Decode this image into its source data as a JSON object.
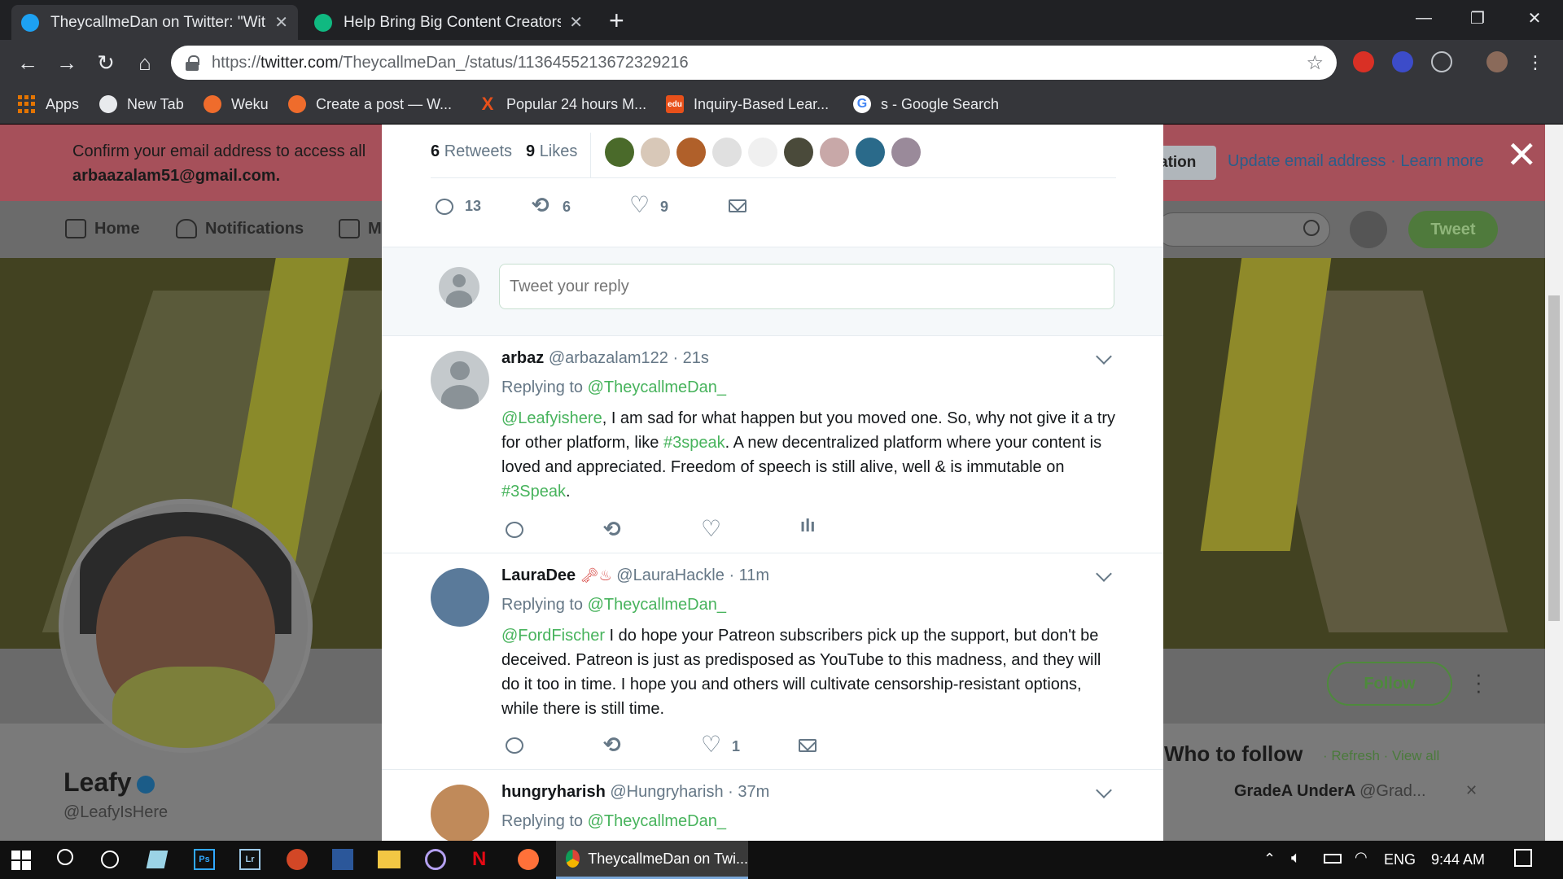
{
  "browser": {
    "tabs": [
      {
        "title": "TheycallmeDan on Twitter: \"With",
        "favicon": "twitter-bird-icon",
        "active": true
      },
      {
        "title": "Help Bring Big Content Creators",
        "favicon": "content-icon",
        "active": false
      }
    ],
    "url_prefix": "https://",
    "url_host": "twitter.com",
    "url_path": "/TheycallmeDan_/status/1136455213672329216",
    "bookmarks": [
      {
        "label": "Apps",
        "icon": "apps-grid-icon"
      },
      {
        "label": "New Tab",
        "icon": "chrome-icon"
      },
      {
        "label": "Weku",
        "icon": "weku-icon"
      },
      {
        "label": "Create a post — W...",
        "icon": "weku-icon"
      },
      {
        "label": "Popular 24 hours M...",
        "icon": "x-icon"
      },
      {
        "label": "Inquiry-Based Lear...",
        "icon": "edu-icon"
      },
      {
        "label": "s - Google Search",
        "icon": "google-icon"
      }
    ]
  },
  "background_page": {
    "banner_line1": "Confirm your email address to access all",
    "banner_email": "arbaazalam51@gmail.com",
    "banner_email_suffix": ".",
    "banner_button": "ation",
    "banner_links": "Update email address · Learn more",
    "nav": {
      "home": "Home",
      "notifications": "Notifications",
      "messages": "M"
    },
    "search_partial": "r",
    "tweet_button": "Tweet",
    "profile_name": "Leafy",
    "profile_handle": "@LeafyIsHere",
    "follow_button": "Follow",
    "who_to_follow": "Who to follow",
    "wtf_links": "· Refresh · View all",
    "wtf_suggestion_name": "GradeA UnderA",
    "wtf_suggestion_handle": "@Grad..."
  },
  "modal": {
    "retweets_count": "6",
    "retweets_label": "Retweets",
    "likes_count": "9",
    "likes_label": "Likes",
    "actions": {
      "reply": "13",
      "retweet": "6",
      "like": "9"
    },
    "reply_placeholder": "Tweet your reply",
    "replies": [
      {
        "name": "arbaz",
        "handle": "@arbazalam122",
        "time": "· 21s",
        "replying_label": "Replying to",
        "replying_to": "@TheycallmeDan_",
        "mention": "@Leafyishere",
        "text1": ", I am sad for what happen but you moved one. So, why not give it a try for other platform, like ",
        "tag1": "#3speak",
        "text2": ". A new decentralized platform where your content is loved and appreciated. Freedom of speech is still alive, well & is immutable on ",
        "tag2": "#3Speak",
        "text3": "."
      },
      {
        "name": "LauraDee",
        "emoji": "🗝♨",
        "handle": "@LauraHackle",
        "time": "· 11m",
        "replying_label": "Replying to",
        "replying_to": "@TheycallmeDan_",
        "mention": "@FordFischer",
        "text1": " I do hope your Patreon subscribers pick up the support, but don't be deceived. Patreon is just as predisposed as YouTube to this madness, and they will do it too in time. I hope you and others will cultivate censorship-resistant options, while there is still time.",
        "like_count": "1"
      },
      {
        "name": "hungryharish",
        "handle": "@Hungryharish",
        "time": "· 37m",
        "replying_label": "Replying to",
        "replying_to": "@TheycallmeDan_"
      }
    ]
  },
  "taskbar": {
    "active_app": "TheycallmeDan on Twi...",
    "language": "ENG",
    "time": "9:44 AM"
  },
  "colors": {
    "twitter_green": "#47b35c",
    "chrome_dark": "#202124"
  }
}
